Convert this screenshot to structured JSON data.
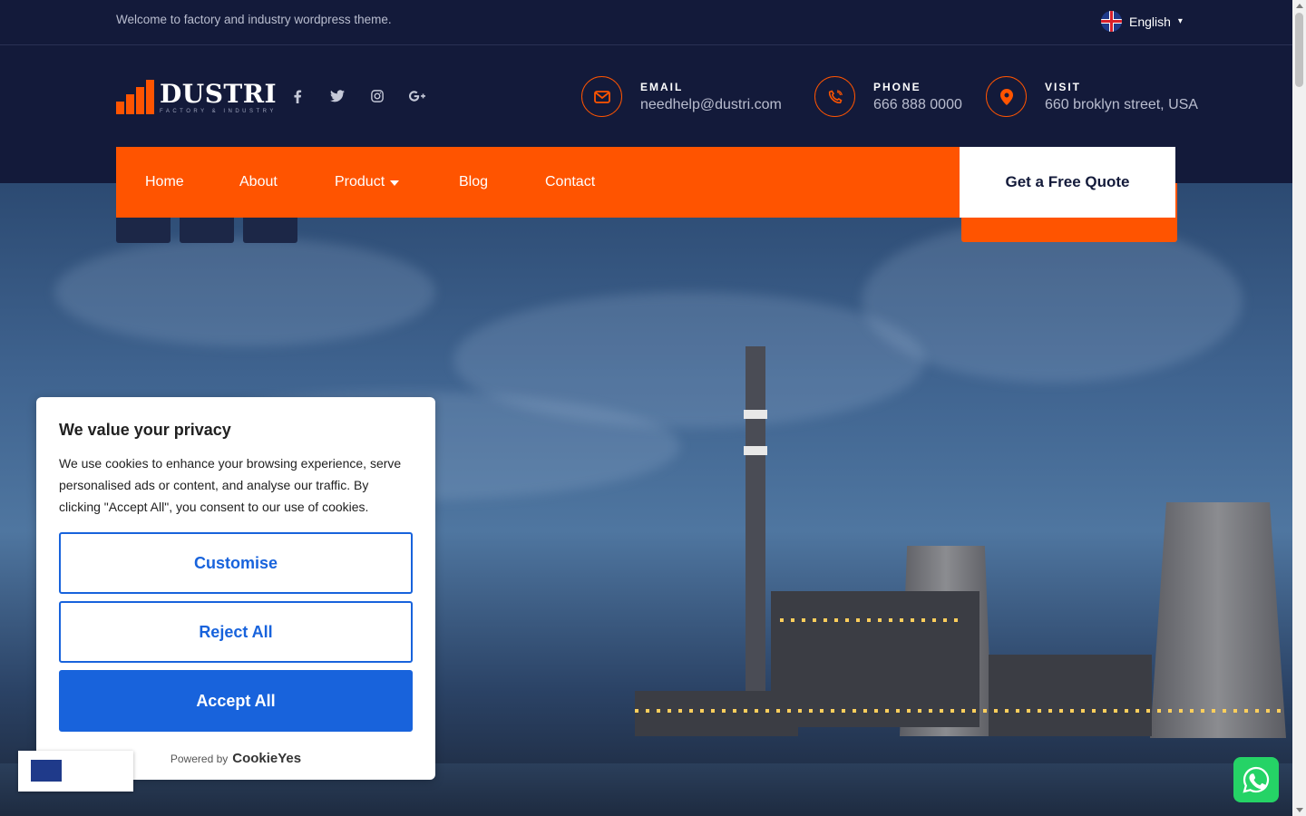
{
  "topbar": {
    "welcome": "Welcome to factory and industry wordpress theme.",
    "language": "English"
  },
  "logo": {
    "title": "DUSTRI",
    "tagline": "FACTORY & INDUSTRY"
  },
  "socials": [
    "facebook-icon",
    "twitter-icon",
    "instagram-icon",
    "google-plus-icon"
  ],
  "contacts": {
    "email": {
      "label": "EMAIL",
      "value": "needhelp@dustri.com"
    },
    "phone": {
      "label": "PHONE",
      "value": "666 888 0000"
    },
    "visit": {
      "label": "VISIT",
      "value": "660 broklyn street, USA"
    }
  },
  "nav": {
    "items": [
      "Home",
      "About",
      "Product",
      "Blog",
      "Contact"
    ],
    "quote": "Get a Free Quote"
  },
  "cookie": {
    "title": "We value your privacy",
    "body": "We use cookies to enhance your browsing experience, serve personalised ads or content, and analyse our traffic. By clicking \"Accept All\", you consent to our use of cookies.",
    "customise": "Customise",
    "reject": "Reject All",
    "accept": "Accept All",
    "powered_by": "Powered by",
    "brand": "CookieYes"
  },
  "colors": {
    "navy": "#131a3a",
    "accent": "#ff5400",
    "cookie_blue": "#1863dc"
  }
}
